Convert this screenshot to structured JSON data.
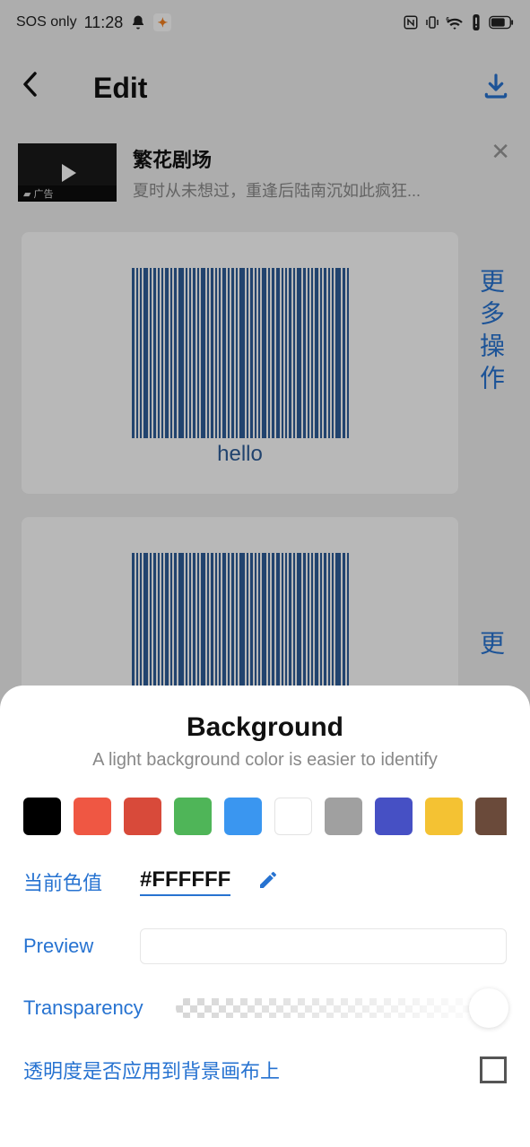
{
  "status": {
    "network": "SOS only",
    "time": "11:28",
    "icons": [
      "bell",
      "runner",
      "nfc",
      "vibrate",
      "wifi-6",
      "alert",
      "battery"
    ]
  },
  "header": {
    "title": "Edit"
  },
  "ad": {
    "title": "繁花剧场",
    "desc": "夏时从未想过，重逢后陆南沉如此疯狂...",
    "badge": "▰ 广告"
  },
  "barcode": {
    "label": "hello",
    "color": "#2e5e99"
  },
  "side_label": "更多操作",
  "side_label_2": "更",
  "sheet": {
    "title": "Background",
    "subtitle": "A light background color is easier to identify",
    "swatches": [
      "#000000",
      "#ef5743",
      "#d84a3a",
      "#4fb558",
      "#3a96f0",
      "#ffffff",
      "#a0a0a0",
      "#4650c4",
      "#f4c233",
      "#6a4a3a"
    ],
    "current_label": "当前色值",
    "current_hex": "#FFFFFF",
    "preview_label": "Preview",
    "transparency_label": "Transparency",
    "apply_label": "透明度是否应用到背景画布上"
  }
}
